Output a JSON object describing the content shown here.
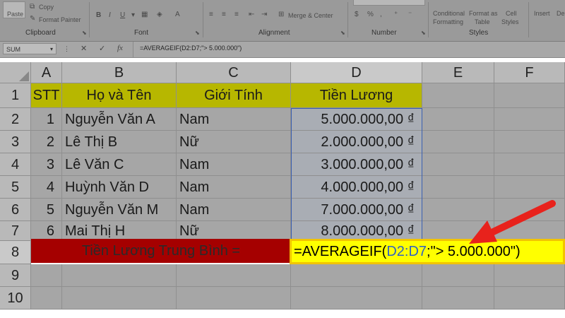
{
  "ribbon": {
    "paste_label": "Paste",
    "copy_label": "Copy",
    "format_painter_label": "Format Painter",
    "clipboard_group": "Clipboard",
    "font_group": "Font",
    "merge_label": "Merge & Center",
    "alignment_group": "Alignment",
    "number_group": "Number",
    "conditional_formatting_label_1": "Conditional",
    "conditional_formatting_label_2": "Formatting",
    "format_as_table_label_1": "Format as",
    "format_as_table_label_2": "Table",
    "cell_styles_label_1": "Cell",
    "cell_styles_label_2": "Styles",
    "styles_group": "Styles",
    "insert_label": "Insert",
    "delete_label": "Dele"
  },
  "formula_bar": {
    "name_box": "SUM",
    "cancel_glyph": "✕",
    "enter_glyph": "✓",
    "fx_glyph": "fx",
    "formula": "=AVERAGEIF(D2:D7;\"> 5.000.000\")"
  },
  "columns": [
    "A",
    "B",
    "C",
    "D",
    "E",
    "F"
  ],
  "rows": [
    "1",
    "2",
    "3",
    "4",
    "5",
    "6",
    "7",
    "8",
    "9",
    "10"
  ],
  "header_row": {
    "stt": "STT",
    "name": "Họ và Tên",
    "gender": "Giới Tính",
    "salary": "Tiền Lương"
  },
  "data_rows": [
    {
      "stt": "1",
      "name": "Nguyễn Văn A",
      "gender": "Nam",
      "salary": "5.000.000,00 ₫"
    },
    {
      "stt": "2",
      "name": "Lê Thị B",
      "gender": "Nữ",
      "salary": "2.000.000,00 ₫"
    },
    {
      "stt": "3",
      "name": "Lê Văn C",
      "gender": "Nam",
      "salary": "3.000.000,00 ₫"
    },
    {
      "stt": "4",
      "name": "Huỳnh Văn D",
      "gender": "Nam",
      "salary": "4.000.000,00 ₫"
    },
    {
      "stt": "5",
      "name": "Nguyễn Văn M",
      "gender": "Nam",
      "salary": "7.000.000,00 ₫"
    },
    {
      "stt": "6",
      "name": "Mai Thị H",
      "gender": "Nữ",
      "salary": "8.000.000,00 ₫"
    }
  ],
  "average_row": {
    "label": "Tiền Lương Trung Bình =",
    "formula_prefix": "=AVERAGEIF(",
    "formula_ref": "D2:D7",
    "formula_suffix": ";\"> 5.000.000\")"
  },
  "colors": {
    "ribbon_bg": "#9a9a9a",
    "header_fill": "#b7b700",
    "avg_label_fill": "#a50000",
    "active_cell_fill": "#ffff00",
    "arrow": "#e8221c",
    "range_ref": "#2f62c4"
  }
}
